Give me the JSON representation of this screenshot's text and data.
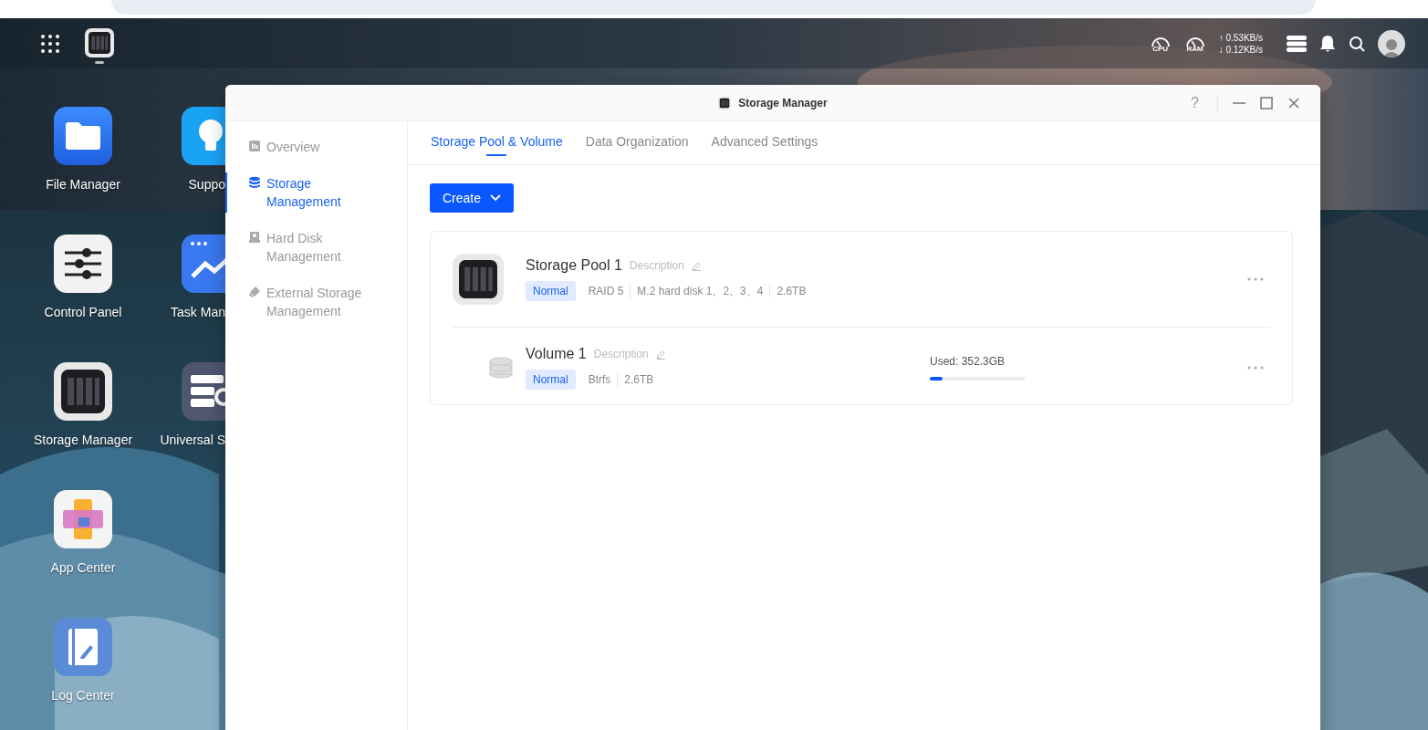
{
  "desktop": {
    "columns": [
      {
        "icons": [
          {
            "label": "File Manager",
            "kind": "folder"
          },
          {
            "label": "Control Panel",
            "kind": "sliders"
          },
          {
            "label": "Storage Manager",
            "kind": "storage"
          },
          {
            "label": "App Center",
            "kind": "apps"
          },
          {
            "label": "Log Center",
            "kind": "log"
          }
        ]
      },
      {
        "icons": [
          {
            "label": "Suppo",
            "kind": "bulb"
          },
          {
            "label": "Task Man",
            "kind": "chart"
          },
          {
            "label": "Universal S",
            "kind": "server"
          }
        ]
      }
    ]
  },
  "taskbar": {
    "pinned": [
      {
        "kind": "storage",
        "running": true
      }
    ],
    "monitors": [
      {
        "label": "CPU"
      },
      {
        "label": "RAM"
      }
    ],
    "network": {
      "upload": "↑ 0.53KB/s",
      "download": "↓ 0.12KB/s"
    }
  },
  "window": {
    "title": "Storage Manager",
    "help": "?",
    "sidebar": {
      "items": [
        {
          "label": "Overview",
          "kind": "overview",
          "selected": false
        },
        {
          "label": "Storage Management",
          "kind": "storage",
          "selected": true
        },
        {
          "label": "Hard Disk Management",
          "kind": "disk",
          "selected": false
        },
        {
          "label": "External Storage Management",
          "kind": "external",
          "selected": false
        }
      ]
    },
    "tabs": [
      {
        "label": "Storage Pool & Volume",
        "selected": true
      },
      {
        "label": "Data Organization",
        "selected": false
      },
      {
        "label": "Advanced Settings",
        "selected": false
      }
    ],
    "create_button": "Create",
    "pools": [
      {
        "name": "Storage Pool 1",
        "description": "Description",
        "status": "Normal",
        "details": [
          "RAID 5",
          "M.2 hard disk 1、2、3、4",
          "2.6TB"
        ],
        "volumes": [
          {
            "name": "Volume 1",
            "description": "Description",
            "status": "Normal",
            "details": [
              "Btrfs",
              "2.6TB"
            ],
            "used": "Used: 352.3GB",
            "level": 0.13
          }
        ]
      }
    ]
  }
}
